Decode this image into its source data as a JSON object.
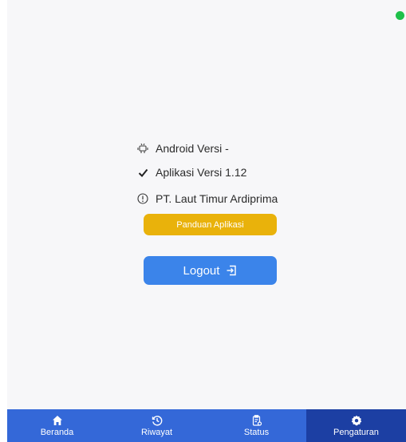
{
  "info": {
    "android_version": "Android Versi -",
    "app_version": "Aplikasi Versi 1.12",
    "company": "PT. Laut Timur Ardiprima"
  },
  "buttons": {
    "guide_label": "Panduan Aplikasi",
    "logout_label": "Logout"
  },
  "nav": {
    "items": [
      {
        "label": "Beranda",
        "icon": "home-icon"
      },
      {
        "label": "Riwayat",
        "icon": "history-icon"
      },
      {
        "label": "Status",
        "icon": "clipboard-icon"
      },
      {
        "label": "Pengaturan",
        "icon": "gear-icon"
      }
    ],
    "active_index": 3
  },
  "colors": {
    "guide_button": "#e9b20b",
    "logout_button": "#3b84ea",
    "nav_background": "#3468d8",
    "nav_active": "#1c3fa3",
    "status_dot": "#1fc04a"
  }
}
